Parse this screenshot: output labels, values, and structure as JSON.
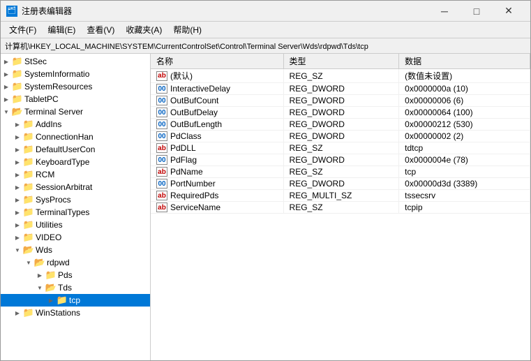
{
  "window": {
    "title": "注册表编辑器",
    "icon": "📋"
  },
  "titlebar": {
    "minimize_label": "─",
    "maximize_label": "□",
    "close_label": "✕"
  },
  "menu": {
    "items": [
      {
        "label": "文件(F)"
      },
      {
        "label": "编辑(E)"
      },
      {
        "label": "查看(V)"
      },
      {
        "label": "收藏夹(A)"
      },
      {
        "label": "帮助(H)"
      }
    ]
  },
  "address": {
    "path": "计算机\\HKEY_LOCAL_MACHINE\\SYSTEM\\CurrentControlSet\\Control\\Terminal Server\\Wds\\rdpwd\\Tds\\tcp"
  },
  "tree": {
    "items": [
      {
        "id": "stsec",
        "label": "StSec",
        "indent": 1,
        "expanded": false,
        "selected": false
      },
      {
        "id": "systeminfo",
        "label": "SystemInformatio",
        "indent": 1,
        "expanded": false,
        "selected": false
      },
      {
        "id": "sysres",
        "label": "SystemResources",
        "indent": 1,
        "expanded": false,
        "selected": false
      },
      {
        "id": "tabletpc",
        "label": "TabletPC",
        "indent": 1,
        "expanded": false,
        "selected": false
      },
      {
        "id": "termserver",
        "label": "Terminal Server",
        "indent": 1,
        "expanded": true,
        "selected": false
      },
      {
        "id": "addins",
        "label": "AddIns",
        "indent": 2,
        "expanded": false,
        "selected": false
      },
      {
        "id": "connhan",
        "label": "ConnectionHan",
        "indent": 2,
        "expanded": false,
        "selected": false
      },
      {
        "id": "defaultuser",
        "label": "DefaultUserCon",
        "indent": 2,
        "expanded": false,
        "selected": false
      },
      {
        "id": "keyboardtype",
        "label": "KeyboardType",
        "indent": 2,
        "expanded": false,
        "selected": false
      },
      {
        "id": "rcm",
        "label": "RCM",
        "indent": 2,
        "expanded": false,
        "selected": false
      },
      {
        "id": "sessionarb",
        "label": "SessionArbitrat",
        "indent": 2,
        "expanded": false,
        "selected": false
      },
      {
        "id": "sysprocs",
        "label": "SysProcs",
        "indent": 2,
        "expanded": false,
        "selected": false
      },
      {
        "id": "terminaltypes",
        "label": "TerminalTypes",
        "indent": 2,
        "expanded": false,
        "selected": false
      },
      {
        "id": "utilities",
        "label": "Utilities",
        "indent": 2,
        "expanded": false,
        "selected": false
      },
      {
        "id": "video",
        "label": "VIDEO",
        "indent": 2,
        "expanded": false,
        "selected": false
      },
      {
        "id": "wds",
        "label": "Wds",
        "indent": 2,
        "expanded": true,
        "selected": false
      },
      {
        "id": "rdpwd",
        "label": "rdpwd",
        "indent": 3,
        "expanded": true,
        "selected": false
      },
      {
        "id": "pds",
        "label": "Pds",
        "indent": 4,
        "expanded": false,
        "selected": false
      },
      {
        "id": "tds",
        "label": "Tds",
        "indent": 4,
        "expanded": true,
        "selected": false
      },
      {
        "id": "tcp",
        "label": "tcp",
        "indent": 5,
        "expanded": false,
        "selected": true
      },
      {
        "id": "winstations",
        "label": "WinStations",
        "indent": 2,
        "expanded": false,
        "selected": false
      }
    ]
  },
  "table": {
    "headers": [
      "名称",
      "类型",
      "数据"
    ],
    "rows": [
      {
        "name": "(默认)",
        "icon": "ab",
        "type": "REG_SZ",
        "data": "(数值未设置)"
      },
      {
        "name": "InteractiveDelay",
        "icon": "dword",
        "type": "REG_DWORD",
        "data": "0x0000000a (10)"
      },
      {
        "name": "OutBufCount",
        "icon": "dword",
        "type": "REG_DWORD",
        "data": "0x00000006 (6)"
      },
      {
        "name": "OutBufDelay",
        "icon": "dword",
        "type": "REG_DWORD",
        "data": "0x00000064 (100)"
      },
      {
        "name": "OutBufLength",
        "icon": "dword",
        "type": "REG_DWORD",
        "data": "0x00000212 (530)"
      },
      {
        "name": "PdClass",
        "icon": "dword",
        "type": "REG_DWORD",
        "data": "0x00000002 (2)"
      },
      {
        "name": "PdDLL",
        "icon": "ab",
        "type": "REG_SZ",
        "data": "tdtcp"
      },
      {
        "name": "PdFlag",
        "icon": "dword",
        "type": "REG_DWORD",
        "data": "0x0000004e (78)"
      },
      {
        "name": "PdName",
        "icon": "ab",
        "type": "REG_SZ",
        "data": "tcp"
      },
      {
        "name": "PortNumber",
        "icon": "dword",
        "type": "REG_DWORD",
        "data": "0x00000d3d (3389)"
      },
      {
        "name": "RequiredPds",
        "icon": "ab",
        "type": "REG_MULTI_SZ",
        "data": "tssecsrv"
      },
      {
        "name": "ServiceName",
        "icon": "ab",
        "type": "REG_SZ",
        "data": "tcpip"
      }
    ]
  }
}
